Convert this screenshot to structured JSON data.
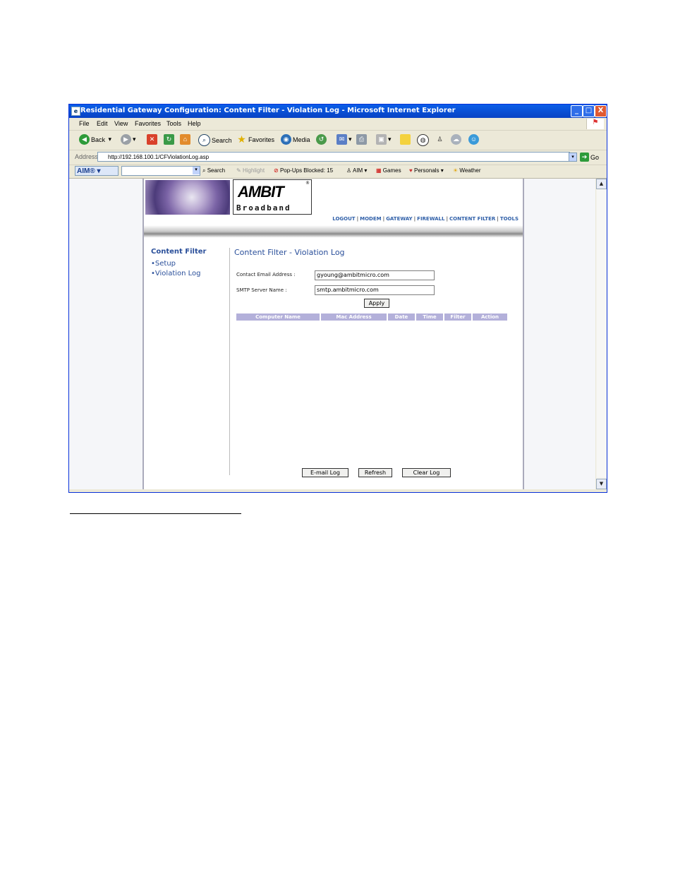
{
  "window": {
    "title": "Residential Gateway Configuration: Content Filter - Violation Log - Microsoft Internet Explorer",
    "controls": {
      "minimize": "_",
      "maximize": "□",
      "close": "X"
    }
  },
  "menu": [
    "File",
    "Edit",
    "View",
    "Favorites",
    "Tools",
    "Help"
  ],
  "toolbar": {
    "back": "Back",
    "search": "Search",
    "favorites": "Favorites",
    "media": "Media"
  },
  "address": {
    "label": "Address",
    "url": "http://192.168.100.1/CFViolationLog.asp",
    "go": "Go"
  },
  "aimbar": {
    "aim": "AIM®",
    "search": "Search",
    "highlight": "Highlight",
    "popups": "Pop-Ups Blocked: 15",
    "aim_menu": "AIM",
    "games": "Games",
    "personals": "Personals",
    "weather": "Weather"
  },
  "logo": {
    "ambit": "AMBIT",
    "broadband": "Broadband",
    "reg": "®"
  },
  "topnav": [
    "LOGOUT",
    "MODEM",
    "GATEWAY",
    "FIREWALL",
    "CONTENT FILTER",
    "TOOLS"
  ],
  "leftnav": {
    "heading": "Content Filter",
    "items": [
      "Setup",
      "Violation Log"
    ]
  },
  "main": {
    "title": "Content Filter - Violation Log",
    "email_label": "Contact Email Address :",
    "email_value": "gyoung@ambitmicro.com",
    "smtp_label": "SMTP Server Name :",
    "smtp_value": "smtp.ambitmicro.com",
    "apply": "Apply",
    "columns": [
      "Computer Name",
      "Mac Address",
      "Date",
      "Time",
      "Filter",
      "Action"
    ],
    "buttons": {
      "email_log": "E-mail Log",
      "refresh": "Refresh",
      "clear_log": "Clear Log"
    }
  }
}
